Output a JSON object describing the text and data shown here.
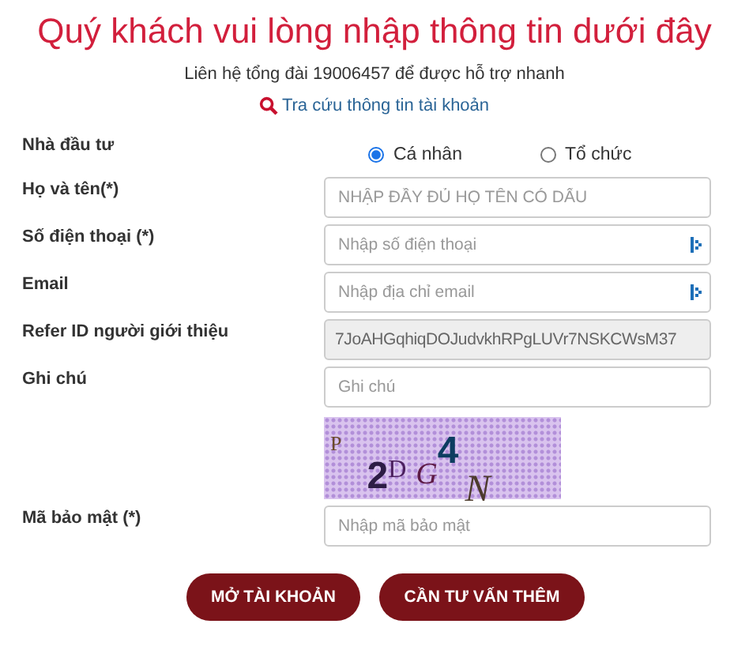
{
  "heading": "Quý khách vui lòng nhập thông tin dưới đây",
  "hotline": "Liên hệ tổng đài 19006457 để được hỗ trợ nhanh",
  "lookup_link": "Tra cứu thông tin tài khoản",
  "investor": {
    "label": "Nhà đầu tư",
    "options": [
      {
        "label": "Cá nhân",
        "selected": true
      },
      {
        "label": "Tổ chức",
        "selected": false
      }
    ]
  },
  "fields": [
    {
      "kind": "input",
      "label": "Họ và tên(*)",
      "placeholder": "NHẬP ĐẦY ĐỦ HỌ TÊN CÓ DẤU",
      "autofill_icon": false
    },
    {
      "kind": "input",
      "label": "Số điện thoại (*)",
      "placeholder": "Nhập số điện thoại",
      "autofill_icon": true
    },
    {
      "kind": "input",
      "label": "Email",
      "placeholder": "Nhập địa chỉ email",
      "autofill_icon": true
    },
    {
      "kind": "readonly",
      "label": "Refer ID người giới thiệu",
      "value": "7JoAHGqhiqDOJudvkhRPgLUVr7NSKCWsM37",
      "autofill_icon": false
    },
    {
      "kind": "input",
      "label": "Ghi chú",
      "placeholder": "Ghi chú",
      "autofill_icon": false
    }
  ],
  "captcha": {
    "chars": [
      "P",
      "2",
      "D",
      "G",
      "4",
      "N"
    ]
  },
  "security": {
    "label": "Mã bảo mật (*)",
    "placeholder": "Nhập mã bảo mật"
  },
  "buttons": [
    "MỞ TÀI KHOẢN",
    "CẦN TƯ VẤN THÊM"
  ]
}
